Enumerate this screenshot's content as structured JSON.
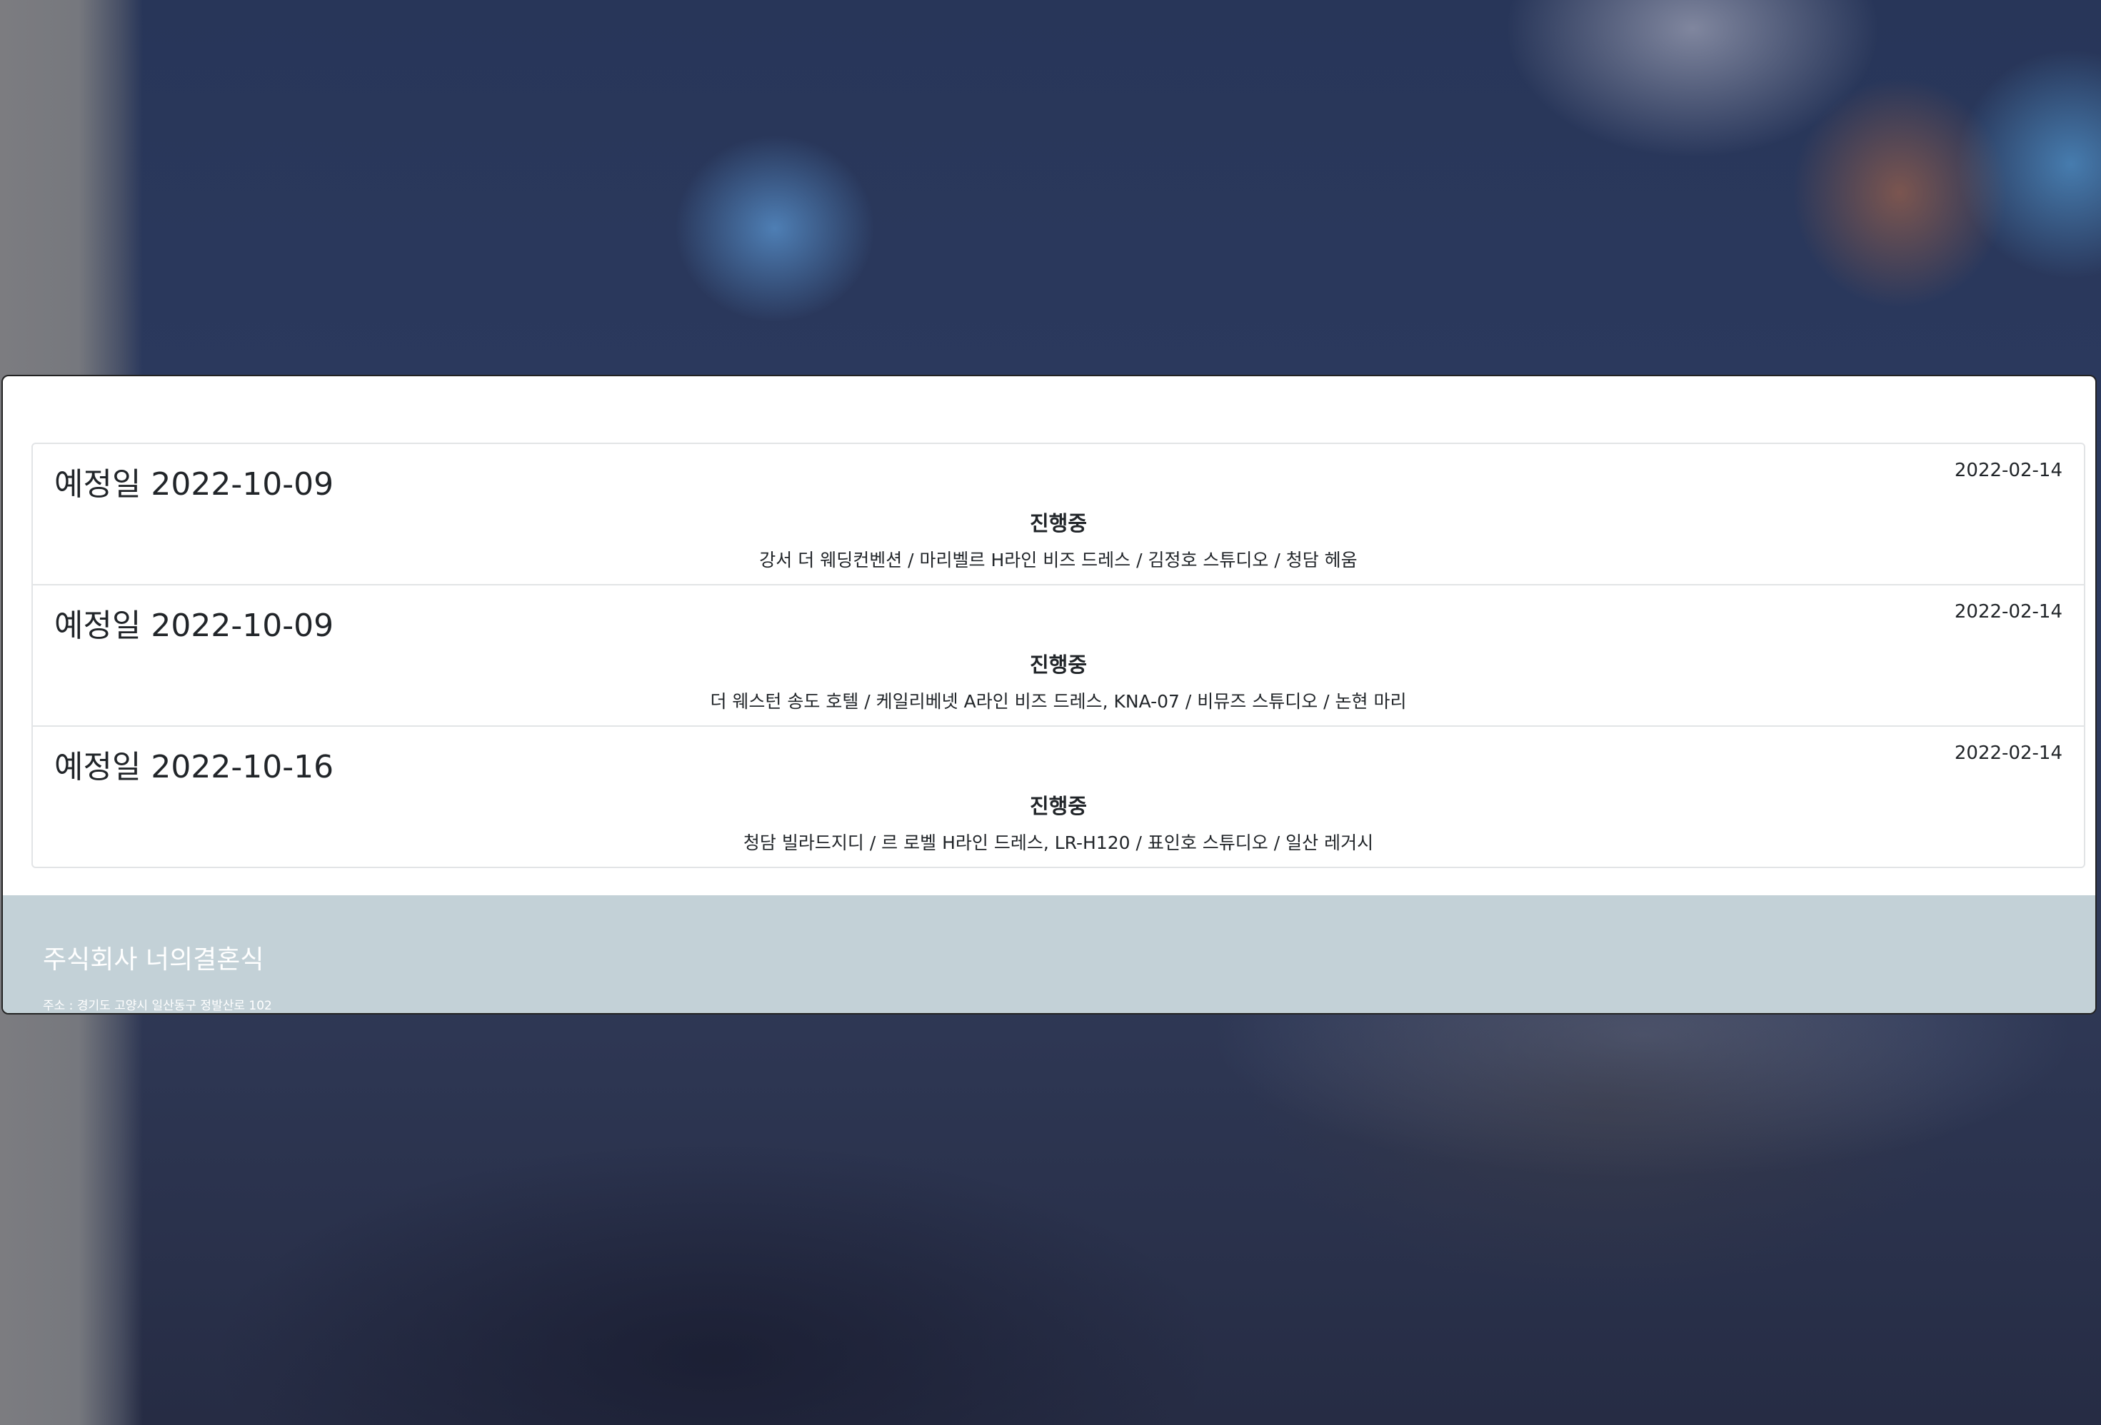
{
  "reservations": [
    {
      "title": "예정일 2022-10-09",
      "created_date": "2022-02-14",
      "status": "진행중",
      "details": "강서 더 웨딩컨벤션 / 마리벨르 H라인 비즈 드레스 / 김정호 스튜디오 / 청담 헤움"
    },
    {
      "title": "예정일 2022-10-09",
      "created_date": "2022-02-14",
      "status": "진행중",
      "details": "더 웨스턴 송도 호텔 / 케일리베넷 A라인 비즈 드레스, KNA-07 / 비뮤즈 스튜디오 / 논현 마리"
    },
    {
      "title": "예정일 2022-10-16",
      "created_date": "2022-02-14",
      "status": "진행중",
      "details": "청담 빌라드지디 / 르 로벨 H라인 드레스, LR-H120 / 표인호 스튜디오 / 일산 레거시"
    }
  ],
  "footer": {
    "company": "주식회사 너의결혼식",
    "address": "주소 : 경기도 고양시 일산동구 정발산로 102"
  },
  "colors": {
    "footer_bg": "#c3d1d7",
    "text": "#212529",
    "border": "#e2e4e6"
  }
}
